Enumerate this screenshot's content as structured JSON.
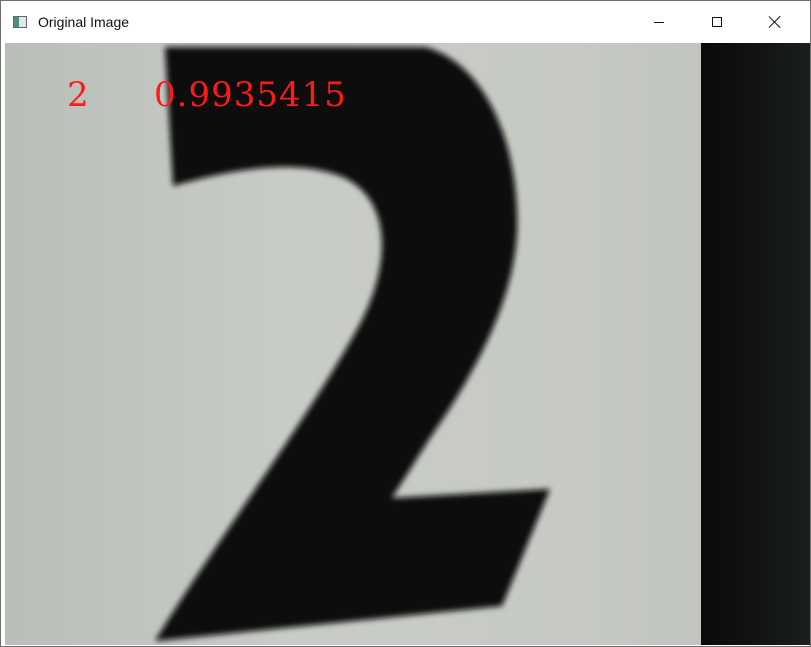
{
  "window": {
    "title": "Original Image",
    "icons": {
      "app": "image-window-icon",
      "minimize": "minimize-icon",
      "maximize": "maximize-icon",
      "close": "close-icon"
    }
  },
  "image": {
    "description_digit": "2",
    "prediction_label": "2",
    "confidence": "0.9935415",
    "overlay_color": "#ff1a1a"
  }
}
